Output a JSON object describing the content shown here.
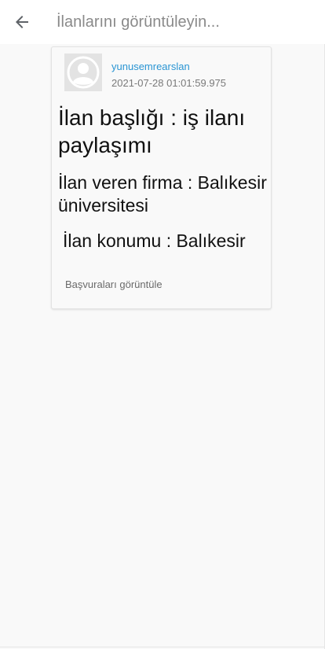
{
  "appbar": {
    "title": "İlanlarını görüntüleyin...",
    "back_icon": "arrow-left-icon"
  },
  "post": {
    "avatar_icon": "default-user-avatar-icon",
    "username": "yunusemrearslan",
    "timestamp": "2021-07-28 01:01:59.975",
    "title": "İlan başlığı : iş ilanı paylaşımı",
    "company": "İlan veren firma : Balıkesir üniversitesi",
    "location": "İlan konumu : Balıkesir",
    "applications_link": "Başvuraları görüntüle"
  },
  "colors": {
    "username": "#2a95d3",
    "background": "#f9f9f9",
    "appbar": "#ffffff"
  }
}
